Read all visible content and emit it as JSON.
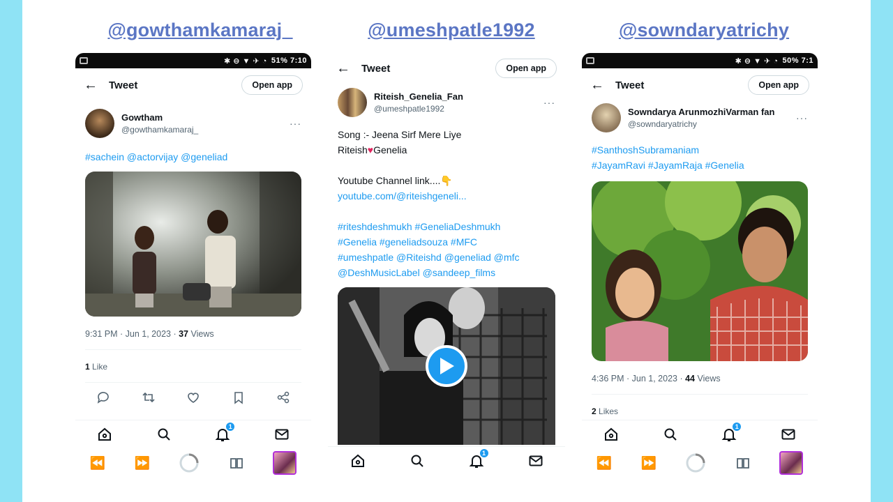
{
  "columns": [
    {
      "title": "@gowthamkamaraj_",
      "status_right": "51% 7:10",
      "top_title": "Tweet",
      "open_app": "Open app",
      "author_name": "Gowtham",
      "author_handle": "@gowthamkamaraj_",
      "text_links": "#sachein @actorvijay @geneliad",
      "meta_time": "9:31 PM · Jun 1, 2023 · ",
      "meta_views": "37",
      "meta_views_label": " Views",
      "likes_count": "1",
      "likes_label": " Like",
      "notif_badge": "1"
    },
    {
      "title": "@umeshpatle1992",
      "top_title": "Tweet",
      "open_app": "Open app",
      "author_name": "Riteish_Genelia_Fan",
      "author_handle": "@umeshpatle1992",
      "line1": "Song :- Jeena Sirf Mere Liye",
      "line2_a": "Riteish",
      "line2_b": "Genelia",
      "line3": "Youtube Channel link....",
      "line4": "youtube.com/@riteishgeneli...",
      "tags": [
        "#riteshdeshmukh #GeneliaDeshmukh",
        "#Genelia #geneliadsouza #MFC",
        "#umeshpatle @Riteishd @geneliad @mfc",
        "@DeshMusicLabel @sandeep_films"
      ],
      "notif_badge": "1"
    },
    {
      "title": "@sowndaryatrichy",
      "status_right": "50% 7:1",
      "top_title": "Tweet",
      "open_app": "Open app",
      "author_name": "Sowndarya ArunmozhiVarman fan",
      "author_handle": "@sowndaryatrichy",
      "tags": [
        "#SanthoshSubramaniam",
        "#JayamRavi #JayamRaja #Genelia"
      ],
      "meta_time": "4:36 PM · Jun 1, 2023 · ",
      "meta_views": "44",
      "meta_views_label": " Views",
      "likes_count": "2",
      "likes_label": " Likes",
      "notif_badge": "1"
    }
  ],
  "colors": {
    "background": "#8fe3f5",
    "title": "#5b76c4",
    "link": "#1d9bf0",
    "heart": "#e0245e"
  }
}
